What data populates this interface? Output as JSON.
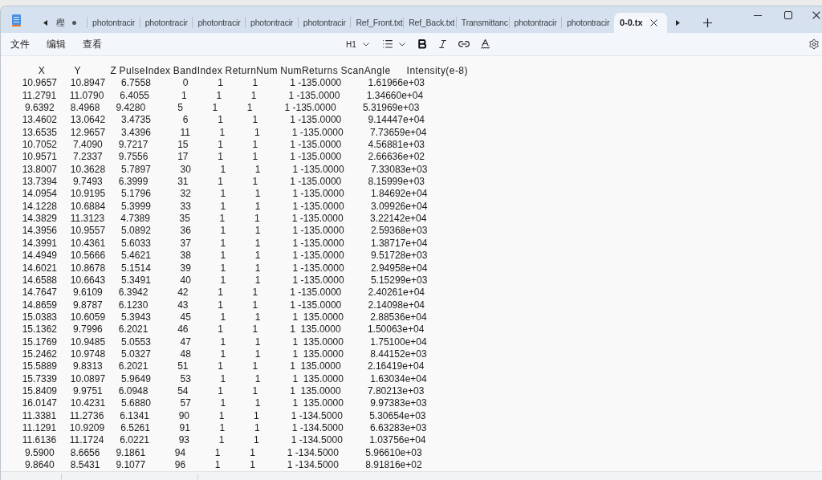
{
  "tab_bar": {
    "tabs": [
      {
        "label": "樫",
        "selected": false,
        "unsaved": true
      },
      {
        "label": "photontracir",
        "selected": false,
        "unsaved": false
      },
      {
        "label": "photontracir",
        "selected": false,
        "unsaved": false
      },
      {
        "label": "photontracir",
        "selected": false,
        "unsaved": false
      },
      {
        "label": "photontracir",
        "selected": false,
        "unsaved": false
      },
      {
        "label": "photontracir",
        "selected": false,
        "unsaved": false
      },
      {
        "label": "Ref_Front.txt",
        "selected": false,
        "unsaved": false
      },
      {
        "label": "Ref_Back.txt",
        "selected": false,
        "unsaved": false
      },
      {
        "label": "Transmittanc",
        "selected": false,
        "unsaved": false
      },
      {
        "label": "photontracir",
        "selected": false,
        "unsaved": false
      },
      {
        "label": "photontracir",
        "selected": false,
        "unsaved": false
      },
      {
        "label": "0-0.tx",
        "selected": true,
        "unsaved": false
      }
    ]
  },
  "menu_bar": {
    "menus": [
      "文件",
      "编辑",
      "查看"
    ]
  },
  "format_toolbar": {
    "heading": "H1"
  },
  "document": {
    "lines": [
      "           X           Y           Z PulseIndex BandIndex ReturnNum NumReturns ScanAngle      Intensity(e-8)",
      "     10.9657     10.8947      6.7558            0           1           1            1 -135.0000          1.61966e+03",
      "     11.2791     11.0790      6.4055            1           1           1            1 -135.0000          1.34660e+04",
      "      9.6392      8.4968      9.4280            5           1           1            1 -135.0000          5.31969e+03",
      "     13.4602     13.0642      3.4735            6           1           1            1 -135.0000          9.14447e+04",
      "     13.6535     12.9657      3.4396           11           1           1            1 -135.0000          7.73659e+04",
      "     10.7052      7.4090      9.7217           15           1           1            1 -135.0000          4.56881e+03",
      "     10.9571      7.2337      9.7556           17           1           1            1 -135.0000          2.66636e+02",
      "     13.8007     10.3628      5.7897           30           1           1            1 -135.0000          7.33083e+03",
      "     13.7394      9.7493      6.3999           31           1           1            1 -135.0000          8.15999e+03",
      "     14.0954     10.9195      5.1796           32           1           1            1 -135.0000          1.84692e+04",
      "     14.1228     10.6884      5.3999           33           1           1            1 -135.0000          3.09926e+04",
      "     14.3829     11.3123      4.7389           35           1           1            1 -135.0000          3.22142e+04",
      "     14.3956     10.9557      5.0892           36           1           1            1 -135.0000          2.59368e+03",
      "     14.3991     10.4361      5.6033           37           1           1            1 -135.0000          1.38717e+04",
      "     14.4949     10.5666      5.4621           38           1           1            1 -135.0000          9.51728e+03",
      "     14.6021     10.8678      5.1514           39           1           1            1 -135.0000          2.94958e+04",
      "     14.6588     10.6643      5.3491           40           1           1            1 -135.0000          5.15299e+03",
      "     14.7647      9.6109      6.3942           42           1           1            1 -135.0000          2.40261e+04",
      "     14.8659      9.8787      6.1230           43           1           1            1 -135.0000          2.14098e+04",
      "     15.0383     10.6059      5.3943           45           1           1            1  135.0000          2.88536e+04",
      "     15.1362      9.7996      6.2021           46           1           1            1  135.0000          1.50063e+04",
      "     15.1769     10.9485      5.0553           47           1           1            1  135.0000          1.75100e+04",
      "     15.2462     10.9748      5.0327           48           1           1            1  135.0000          8.44152e+03",
      "     15.5889      9.8313      6.2021           51           1           1            1  135.0000          2.16419e+04",
      "     15.7339     10.0897      5.9649           53           1           1            1  135.0000          1.63034e+04",
      "     15.8409      9.9751      6.0948           54           1           1            1  135.0000          7.80213e+03",
      "     16.0147     10.4231      5.6880           57           1           1            1  135.0000          9.97383e+03",
      "     11.3381     11.2736      6.1341           90           1           1            1 -134.5000          5.30654e+03",
      "     11.1291     10.9209      6.5261           91           1           1            1 -134.5000          6.63283e+03",
      "     11.6136     11.1724      6.0221           93           1           1            1 -134.5000          1.03756e+04",
      "      9.5900      8.6656      9.1861           94           1           1            1 -134.5000          5.96610e+03",
      "      9.8640      8.5431      9.1077           96           1           1            1 -134.5000          8.91816e+02"
    ]
  }
}
